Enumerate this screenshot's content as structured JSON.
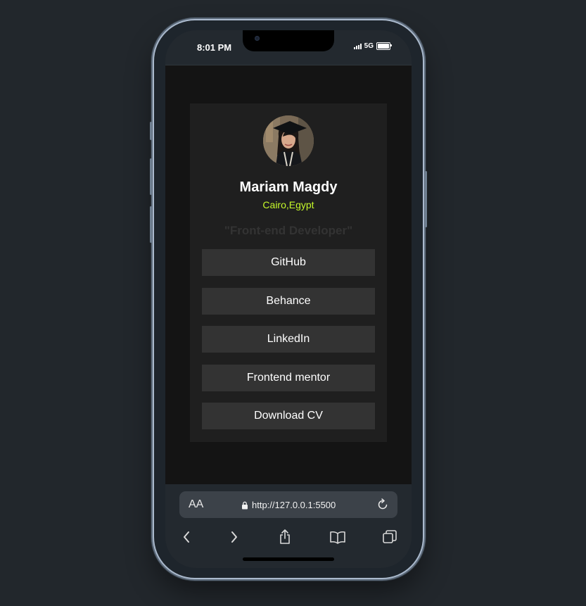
{
  "status_bar": {
    "time": "8:01 PM",
    "network": "5G"
  },
  "profile": {
    "name": "Mariam Magdy",
    "location": "Cairo,Egypt",
    "tagline": "\"Front-end Developer\""
  },
  "links": [
    {
      "label": "GitHub"
    },
    {
      "label": "Behance"
    },
    {
      "label": "LinkedIn"
    },
    {
      "label": "Frontend mentor"
    },
    {
      "label": "Download CV"
    }
  ],
  "browser": {
    "text_size_label": "AA",
    "url": "http://127.0.0.1:5500"
  },
  "colors": {
    "page_background": "#141414",
    "card_background": "#1f1f1f",
    "button_background": "#333333",
    "accent_location": "#c5f82a",
    "tagline_text": "#333333"
  },
  "icons": {
    "secure": "lock-icon",
    "reload": "reload-icon",
    "back": "chevron-left-icon",
    "forward": "chevron-right-icon",
    "share": "share-icon",
    "bookmarks": "book-icon",
    "tabs": "tabs-icon"
  }
}
